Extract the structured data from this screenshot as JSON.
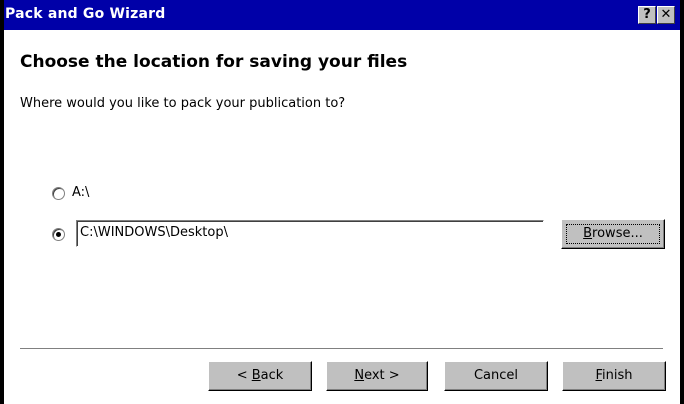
{
  "window": {
    "title": "Pack and Go Wizard",
    "help_glyph": "?",
    "close_glyph": "✕"
  },
  "page": {
    "heading": "Choose the location for saving your files",
    "question": "Where would you like to pack your publication to?"
  },
  "options": [
    {
      "label": "A:\\",
      "selected": false
    },
    {
      "label": "",
      "selected": true
    }
  ],
  "path_field": {
    "value": "C:\\WINDOWS\\Desktop\\"
  },
  "browse": {
    "pre": "",
    "mnemonic": "B",
    "post": "rowse..."
  },
  "buttons": {
    "back": {
      "pre": "< ",
      "mnemonic": "B",
      "post": "ack"
    },
    "next": {
      "pre": "",
      "mnemonic": "N",
      "post": "ext >"
    },
    "cancel": {
      "label": "Cancel"
    },
    "finish": {
      "pre": "",
      "mnemonic": "F",
      "post": "inish"
    }
  },
  "colors": {
    "titlebar": "#0000a8",
    "face": "#c0c0c0",
    "background": "#ffffff"
  }
}
